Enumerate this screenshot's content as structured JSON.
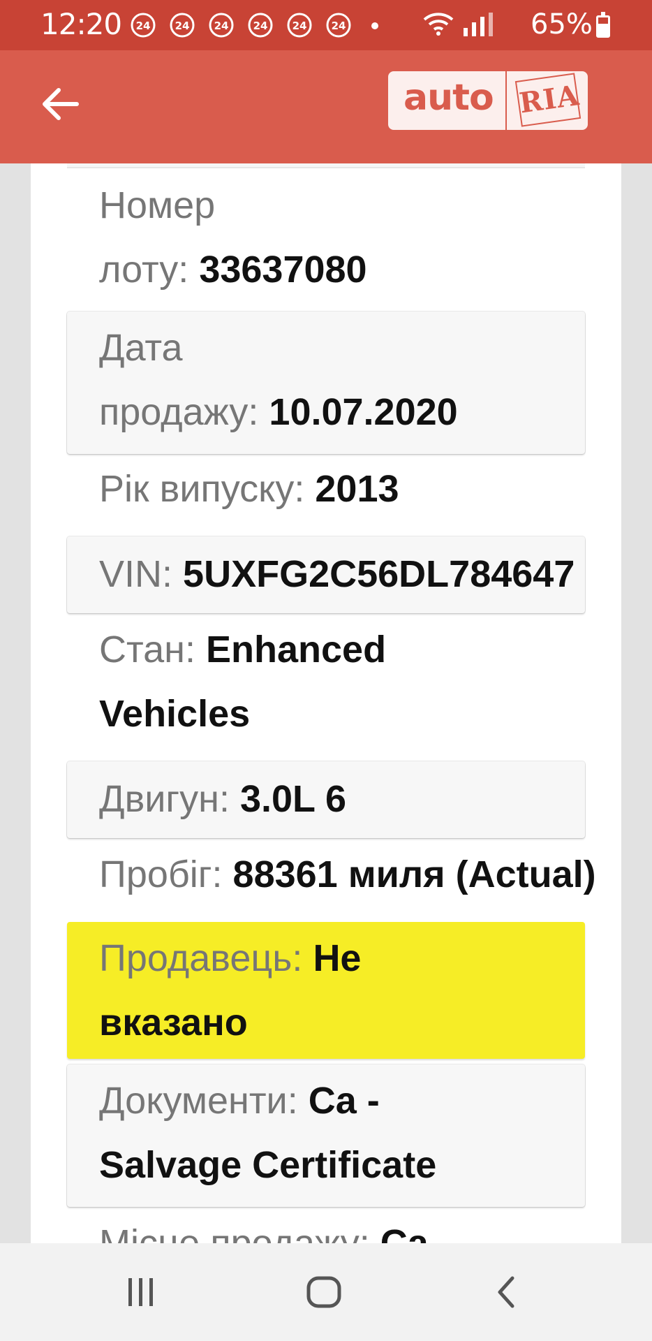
{
  "status_bar": {
    "time": "12:20",
    "notifications": [
      "24",
      "24",
      "24",
      "24",
      "24",
      "24"
    ],
    "battery": "65%"
  },
  "app_bar": {
    "logo_left": "auto",
    "logo_right": "RIA"
  },
  "details": [
    {
      "label": "Номер",
      "label2": "лоту:",
      "value": "33637080"
    },
    {
      "label": "Дата",
      "label2": "продажу:",
      "value": "10.07.2020"
    },
    {
      "label": "Рік випуску:",
      "value": "2013"
    },
    {
      "label": "VIN:",
      "value": "5UXFG2C56DL784647"
    },
    {
      "label": "Стан:",
      "value": "Enhanced",
      "value2": "Vehicles"
    },
    {
      "label": "Двигун:",
      "value": "3.0L 6"
    },
    {
      "label": "Пробіг:",
      "value": "88361 миля (Actual)"
    },
    {
      "label": "Продавець:",
      "value": "Не",
      "value2": "вказано"
    },
    {
      "label": "Документи:",
      "value": "Ca -",
      "value2": "Salvage Certificate"
    },
    {
      "label": "Місце продажу:",
      "value": "Ca"
    }
  ],
  "colors": {
    "status_bar": "#c84335",
    "app_bar": "#d95c4d",
    "highlight": "#f6ed26"
  }
}
